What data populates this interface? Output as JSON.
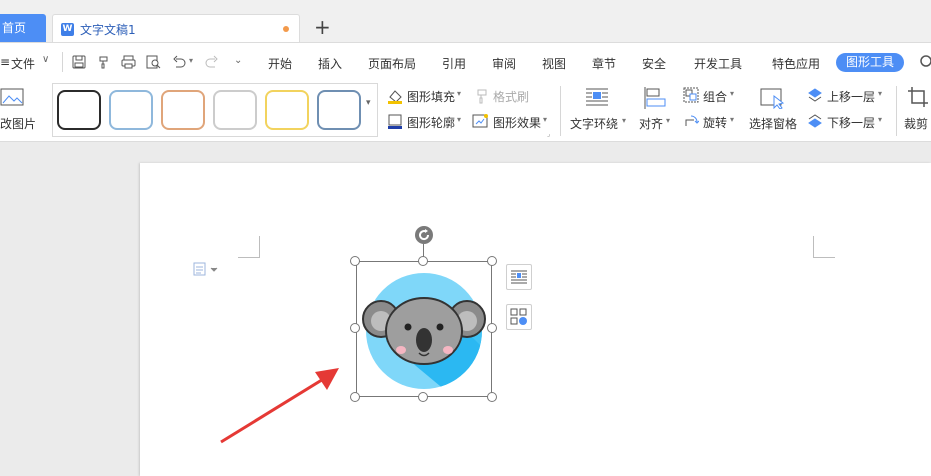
{
  "tabs": {
    "home_label": "首页",
    "doc_title": "文字文稿1",
    "doc_icon": "W",
    "add_label": "+"
  },
  "menu": {
    "file_label": "文件",
    "items": [
      "开始",
      "插入",
      "页面布局",
      "引用",
      "审阅",
      "视图",
      "章节",
      "安全",
      "开发工具",
      "特色应用"
    ],
    "active": "图形工具"
  },
  "ribbon": {
    "change_picture": "改图片",
    "shape_fill": "图形填充",
    "format_painter": "格式刷",
    "shape_outline": "图形轮廓",
    "shape_effect": "图形效果",
    "text_wrap": "文字环绕",
    "align": "对齐",
    "group": "组合",
    "rotate": "旋转",
    "selection_pane": "选择窗格",
    "bring_forward": "上移一层",
    "send_backward": "下移一层",
    "crop": "裁剪",
    "style_colors": [
      "#2b2b2b",
      "#8fb8dc",
      "#e0a57a",
      "#cccccc",
      "#f2d35e",
      "#6f8fb2"
    ]
  },
  "colors": {
    "accent": "#4d8ef5",
    "arrow": "#e53935"
  }
}
